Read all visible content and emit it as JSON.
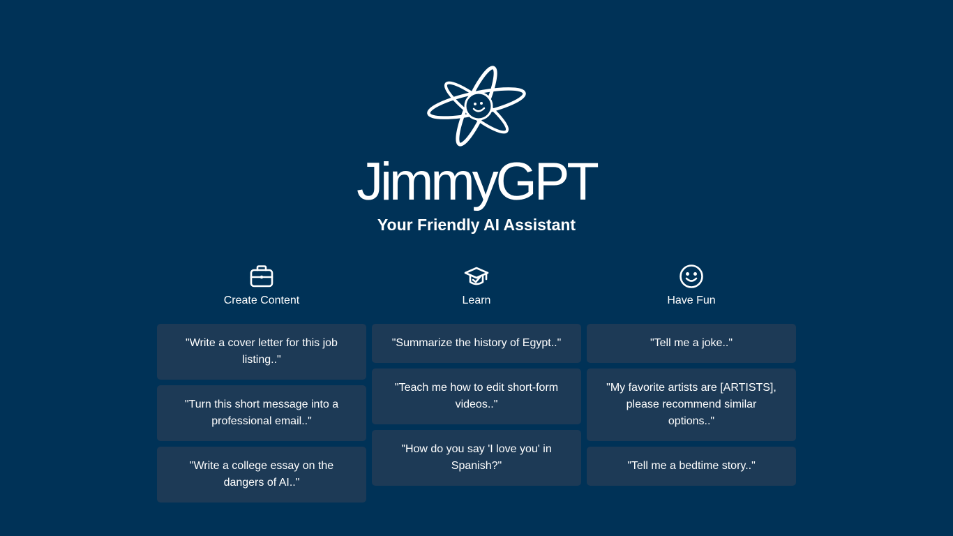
{
  "app": {
    "name": "JimmyGPT",
    "tagline": "Your Friendly AI Assistant"
  },
  "columns": [
    {
      "icon": "briefcase-icon",
      "title": "Create Content",
      "prompts": [
        "\"Write a cover letter for this job listing..\"",
        "\"Turn this short message into a professional email..\"",
        "\"Write a college essay on the dangers of AI..\""
      ]
    },
    {
      "icon": "graduation-cap-icon",
      "title": "Learn",
      "prompts": [
        "\"Summarize the history of Egypt..\"",
        "\"Teach me how to edit short-form videos..\"",
        "\"How do you say 'I love you' in Spanish?\""
      ]
    },
    {
      "icon": "smiley-face-icon",
      "title": "Have Fun",
      "prompts": [
        "\"Tell me a joke..\"",
        "\"My favorite artists are [ARTISTS], please recommend similar options..\"",
        "\"Tell me a bedtime story..\""
      ]
    }
  ],
  "colors": {
    "background": "#003257",
    "card": "#1d3a56",
    "text": "#ffffff"
  }
}
